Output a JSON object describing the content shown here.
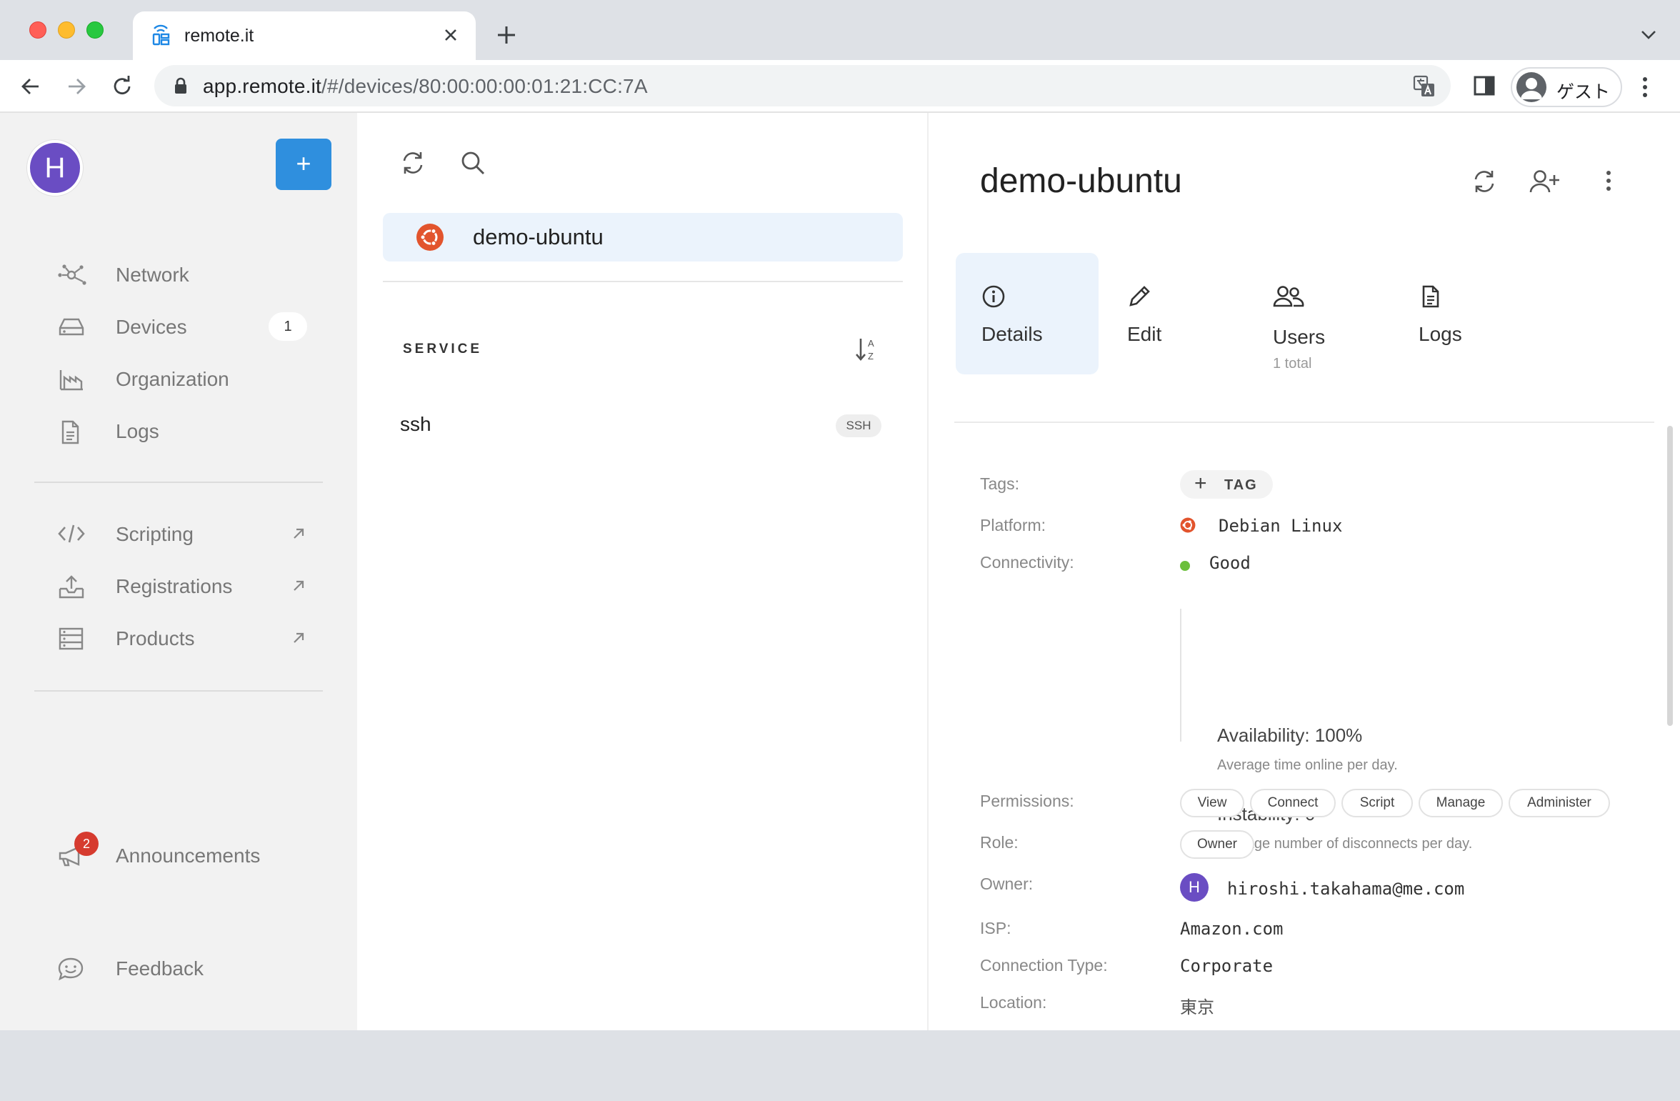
{
  "browser": {
    "tab_title": "remote.it",
    "url_host": "app.remote.it",
    "url_path": "/#/devices/80:00:00:00:01:21:CC:7A",
    "profile_label": "ゲスト"
  },
  "sidebar": {
    "avatar_letter": "H",
    "add_label": "+",
    "items": [
      {
        "label": "Network",
        "icon": "network-icon"
      },
      {
        "label": "Devices",
        "icon": "devices-icon",
        "badge": "1"
      },
      {
        "label": "Organization",
        "icon": "organization-icon"
      },
      {
        "label": "Logs",
        "icon": "logs-icon"
      }
    ],
    "external_items": [
      {
        "label": "Scripting",
        "icon": "code-icon"
      },
      {
        "label": "Registrations",
        "icon": "upload-icon"
      },
      {
        "label": "Products",
        "icon": "products-icon"
      }
    ],
    "announcements_label": "Announcements",
    "announcements_count": "2",
    "feedback_label": "Feedback"
  },
  "device_list": {
    "device_name": "demo-ubuntu",
    "service_header": "SERVICE",
    "services": [
      {
        "name": "ssh",
        "type": "SSH"
      }
    ]
  },
  "details": {
    "title": "demo-ubuntu",
    "tabs": [
      {
        "label": "Details",
        "icon": "info-icon"
      },
      {
        "label": "Edit",
        "icon": "pencil-icon"
      },
      {
        "label": "Users",
        "sub": "1 total",
        "icon": "users-icon"
      },
      {
        "label": "Logs",
        "icon": "document-icon"
      }
    ],
    "labels": {
      "tags": "Tags:",
      "platform": "Platform:",
      "connectivity": "Connectivity:",
      "permissions": "Permissions:",
      "role": "Role:",
      "owner": "Owner:",
      "isp": "ISP:",
      "connection_type": "Connection Type:",
      "location": "Location:"
    },
    "tag_button": "TAG",
    "platform": "Debian Linux",
    "connectivity": "Good",
    "availability_title": "Availability: 100%",
    "availability_sub": "Average time online per day.",
    "instability_title": "Instability: 0",
    "instability_sub": "Average number of disconnects per day.",
    "permissions": [
      "View",
      "Connect",
      "Script",
      "Manage",
      "Administer"
    ],
    "role": "Owner",
    "owner_letter": "H",
    "owner_email": "hiroshi.takahama@me.com",
    "isp": "Amazon.com",
    "connection_type": "Corporate",
    "location": "東京"
  },
  "colors": {
    "accent": "#2f8fde",
    "avatar": "#6a4dc3",
    "ubuntu": "#e2542d",
    "good": "#6bbf3b",
    "notification": "#d63b2f"
  }
}
